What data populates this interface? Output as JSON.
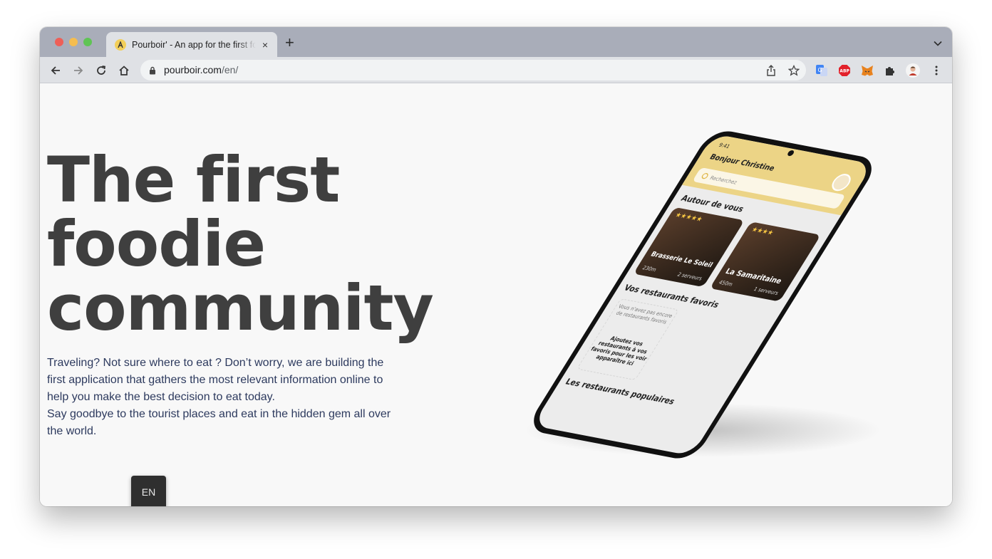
{
  "browser": {
    "tab_title": "Pourboir' - An app for the first foodie community",
    "tab_close": "×",
    "new_tab": "+",
    "url_domain": "pourboir.com",
    "url_path": "/en/"
  },
  "hero": {
    "headline_lines": [
      "The first",
      "foodie",
      "community"
    ],
    "description_1": "Traveling? Not sure where to eat ? Don’t worry, we are building the first application that gathers the most relevant information online to help you make the best decision to eat today.",
    "description_2": "Say goodbye to the tourist places and eat in the hidden gem all over the world."
  },
  "language_button": "EN",
  "phone": {
    "time": "9:41",
    "greeting": "Bonjour Christine",
    "search_placeholder": "Recherchez",
    "section_nearby": "Autour de vous",
    "card1_name": "Brasserie Le Soleil",
    "card1_distance": "230m",
    "card1_waiters": "2 serveurs",
    "card2_name": "La Samaritaine",
    "card2_distance": "450m",
    "card2_waiters": "1 serveurs",
    "section_favorites": "Vos restaurants favoris",
    "empty_fav": "Vous n'avez pas encore de restaurants favoris",
    "add_fav": "Ajoutez vos restaurants à vos favoris pour les voir apparaître ici",
    "section_popular": "Les restaurants populaires"
  },
  "colors": {
    "headline": "#3f3f3f",
    "description": "#2d3a5e",
    "phone_header": "#ecd486"
  }
}
